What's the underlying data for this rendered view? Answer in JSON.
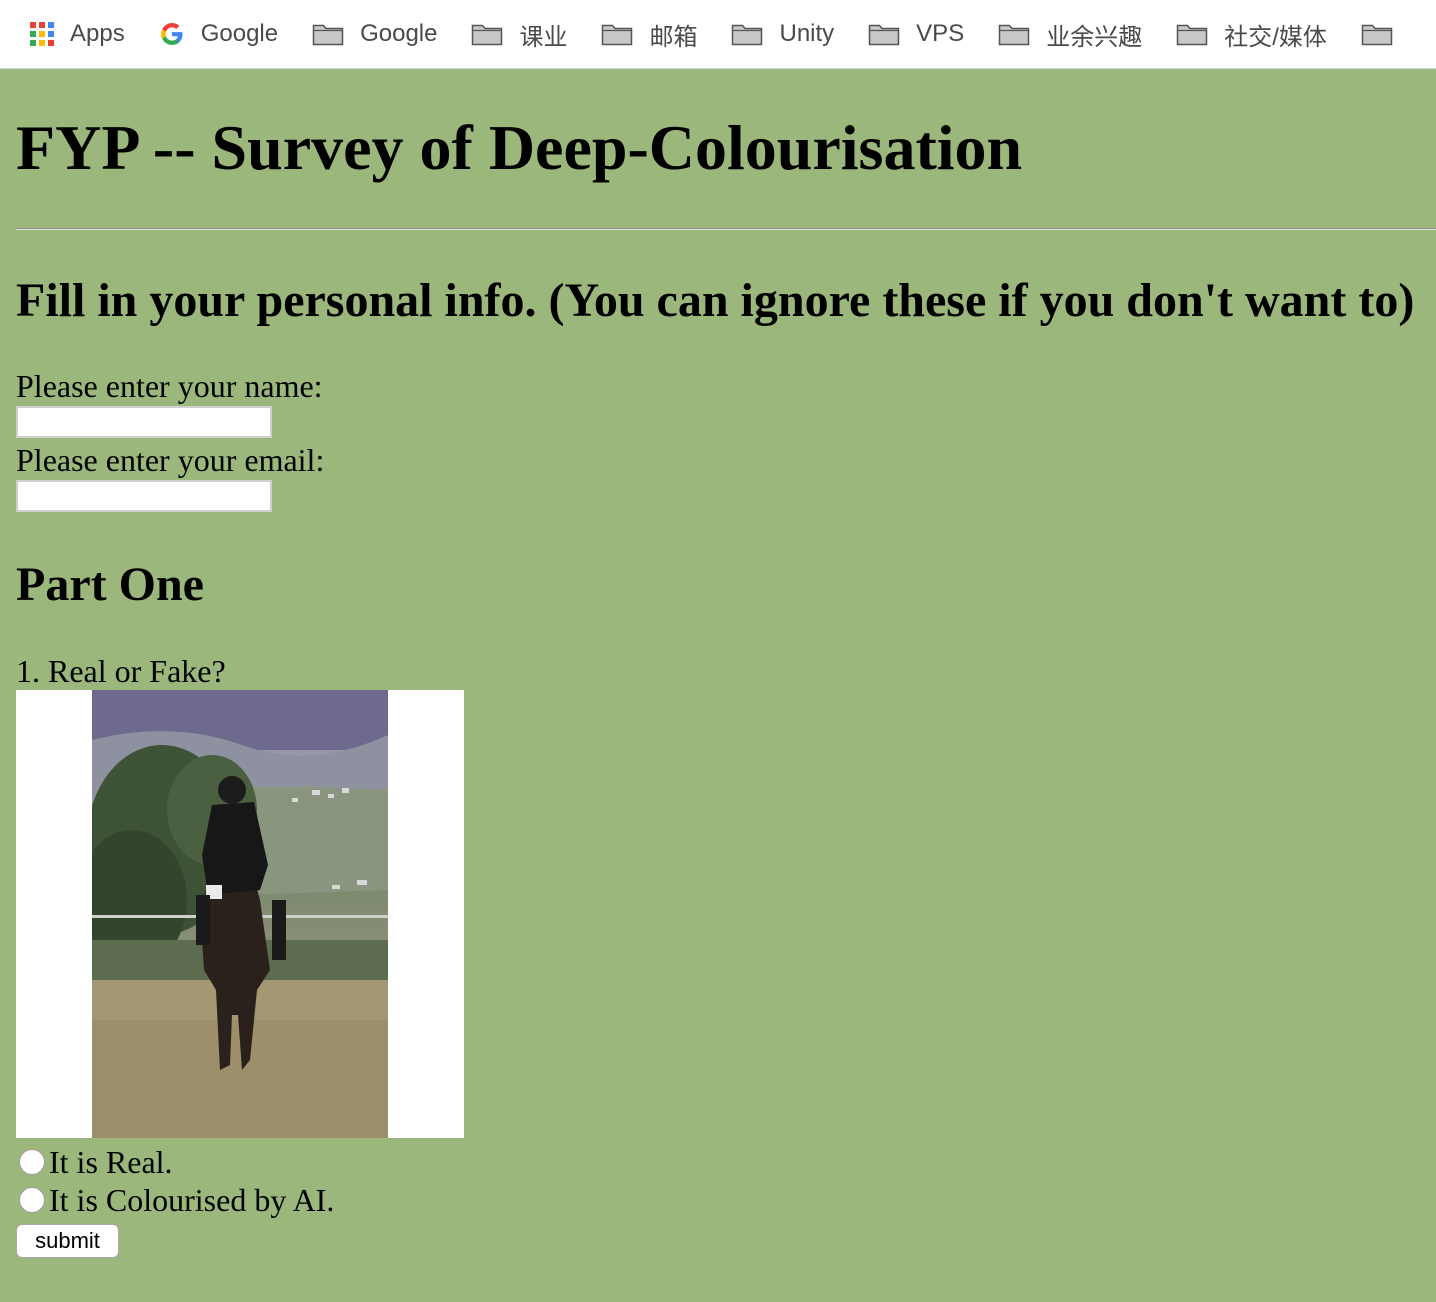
{
  "bookmarks": [
    {
      "label": "Apps",
      "icon": "apps-grid-icon"
    },
    {
      "label": "Google",
      "icon": "google-g-icon"
    },
    {
      "label": "Google",
      "icon": "folder-icon"
    },
    {
      "label": "课业",
      "icon": "folder-icon"
    },
    {
      "label": "邮箱",
      "icon": "folder-icon"
    },
    {
      "label": "Unity",
      "icon": "folder-icon"
    },
    {
      "label": "VPS",
      "icon": "folder-icon"
    },
    {
      "label": "业余兴趣",
      "icon": "folder-icon"
    },
    {
      "label": "社交/媒体",
      "icon": "folder-icon"
    },
    {
      "label": "",
      "icon": "folder-icon"
    }
  ],
  "colors": {
    "page_background": "#9bb77b",
    "bookmarks_background": "#ffffff"
  },
  "page": {
    "title": "FYP -- Survey of Deep-Colourisation",
    "info_heading": "Fill in your personal info. (You can ignore these if you don't want to)",
    "name_label": "Please enter your name:",
    "name_value": "",
    "email_label": "Please enter your email:",
    "email_value": "",
    "part_heading": "Part One",
    "question_1": "1. Real or Fake?",
    "question_1_image": "photo of a rider in black jacket and helmet on a dark horse in a paddock, trees and hills behind",
    "option_real": "It is Real.",
    "option_ai": "It is Colourised by AI.",
    "submit_label": "submit"
  }
}
